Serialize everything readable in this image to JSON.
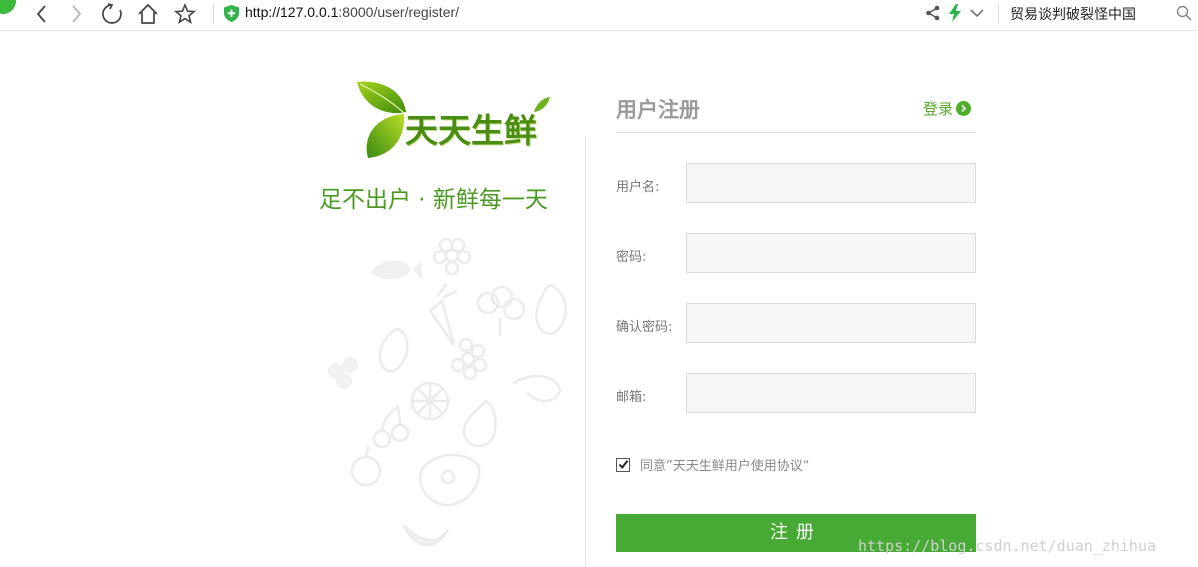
{
  "browser": {
    "url_host": "http://127.0.0.1",
    "url_rest": ":8000/user/register/",
    "news_headline": "贸易谈判破裂怪中国"
  },
  "brand": {
    "logo_text": "天天生鲜",
    "slogan": "足不出户 · 新鲜每一天"
  },
  "form": {
    "title": "用户注册",
    "login_link": "登录",
    "fields": [
      {
        "label": "用户名:",
        "value": "",
        "type": "text"
      },
      {
        "label": "密码:",
        "value": "",
        "type": "password"
      },
      {
        "label": "确认密码:",
        "value": "",
        "type": "password"
      },
      {
        "label": "邮箱:",
        "value": "",
        "type": "text"
      }
    ],
    "agree_checked": true,
    "agree_text": "同意”天天生鲜用户使用协议“",
    "submit_label": "注册"
  },
  "watermark": "https://blog.csdn.net/duan_zhihua",
  "colors": {
    "brand_green": "#47aa34",
    "text_green": "#4a9a21",
    "input_bg": "#f6f6f6"
  },
  "icons": {
    "back": "chevron-left-icon",
    "forward": "chevron-right-icon",
    "reload": "reload-icon",
    "home": "home-icon",
    "bookmark": "star-icon",
    "security": "shield-icon",
    "share": "share-icon",
    "accelerate": "bolt-icon",
    "menu": "chevron-down-icon",
    "search": "search-icon",
    "login_arrow": "arrow-right-circle-icon"
  }
}
